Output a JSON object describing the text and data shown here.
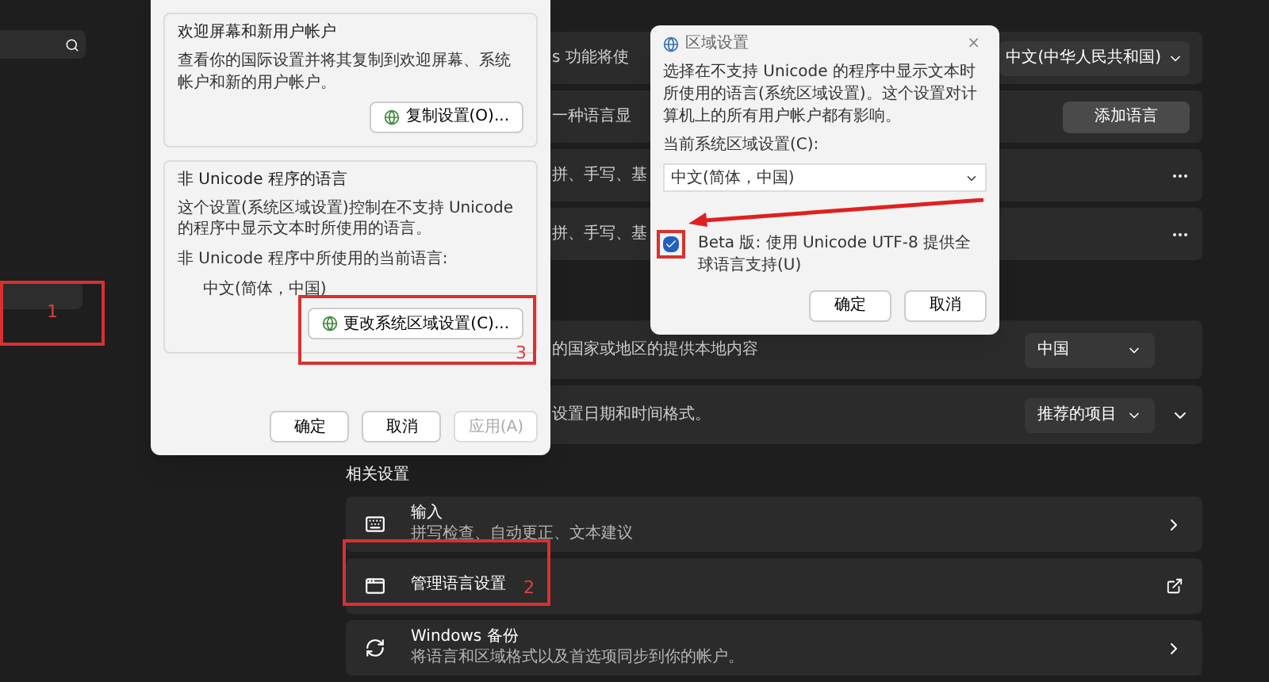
{
  "settings": {
    "top_cards": [
      {
        "kind": "dropdown",
        "description": "s 功能将使",
        "value": "中文(中华人民共和国)"
      },
      {
        "kind": "button",
        "description": "一种语言显",
        "button": "添加语言"
      },
      {
        "kind": "more",
        "description": "拼、手写、基"
      },
      {
        "kind": "more",
        "description": "拼、手写、基"
      }
    ],
    "region_cards": [
      {
        "kind": "dropdown",
        "description": "的国家或地区的提供本地内容",
        "value": "中国",
        "expandable": false
      },
      {
        "kind": "dropdown",
        "description": "设置日期和时间格式。",
        "value": "推荐的项目",
        "expandable": true
      }
    ],
    "related": {
      "heading": "相关设置",
      "items": [
        {
          "kind": "chevron",
          "title": "输入",
          "subtitle": "拼写检查、自动更正、文本建议"
        },
        {
          "kind": "external",
          "title": "管理语言设置"
        },
        {
          "kind": "chevron",
          "title": "Windows 备份",
          "subtitle": "将语言和区域格式以及首选项同步到你的帐户。"
        }
      ]
    }
  },
  "region_dialog": {
    "groups": [
      {
        "title": "欢迎屏幕和新用户帐户",
        "text": "查看你的国际设置并将其复制到欢迎屏幕、系统帐户和新的用户帐户。",
        "button": "复制设置(O)..."
      },
      {
        "title": "非 Unicode 程序的语言",
        "text": "这个设置(系统区域设置)控制在不支持 Unicode 的程序中显示文本时所使用的语言。",
        "sublabel": "非 Unicode 程序中所使用的当前语言:",
        "value": "中文(简体，中国)",
        "button": "更改系统区域设置(C)..."
      }
    ],
    "buttons": [
      {
        "label": "确定",
        "disabled": false
      },
      {
        "label": "取消",
        "disabled": false
      },
      {
        "label": "应用(A)",
        "disabled": true
      }
    ]
  },
  "locale_dialog": {
    "title": "区域设置",
    "close": "×",
    "text": "选择在不支持 Unicode 的程序中显示文本时所使用的语言(系统区域设置)。这个设置对计算机上的所有用户帐户都有影响。",
    "label": "当前系统区域设置(C):",
    "value": "中文(简体，中国)",
    "checkbox": {
      "label": "Beta 版: 使用 Unicode UTF-8 提供全球语言支持(U)",
      "checked": true
    },
    "buttons": [
      "确定",
      "取消"
    ]
  },
  "annotations": [
    {
      "label": "1"
    },
    {
      "label": "3"
    },
    {
      "label": "2"
    }
  ]
}
